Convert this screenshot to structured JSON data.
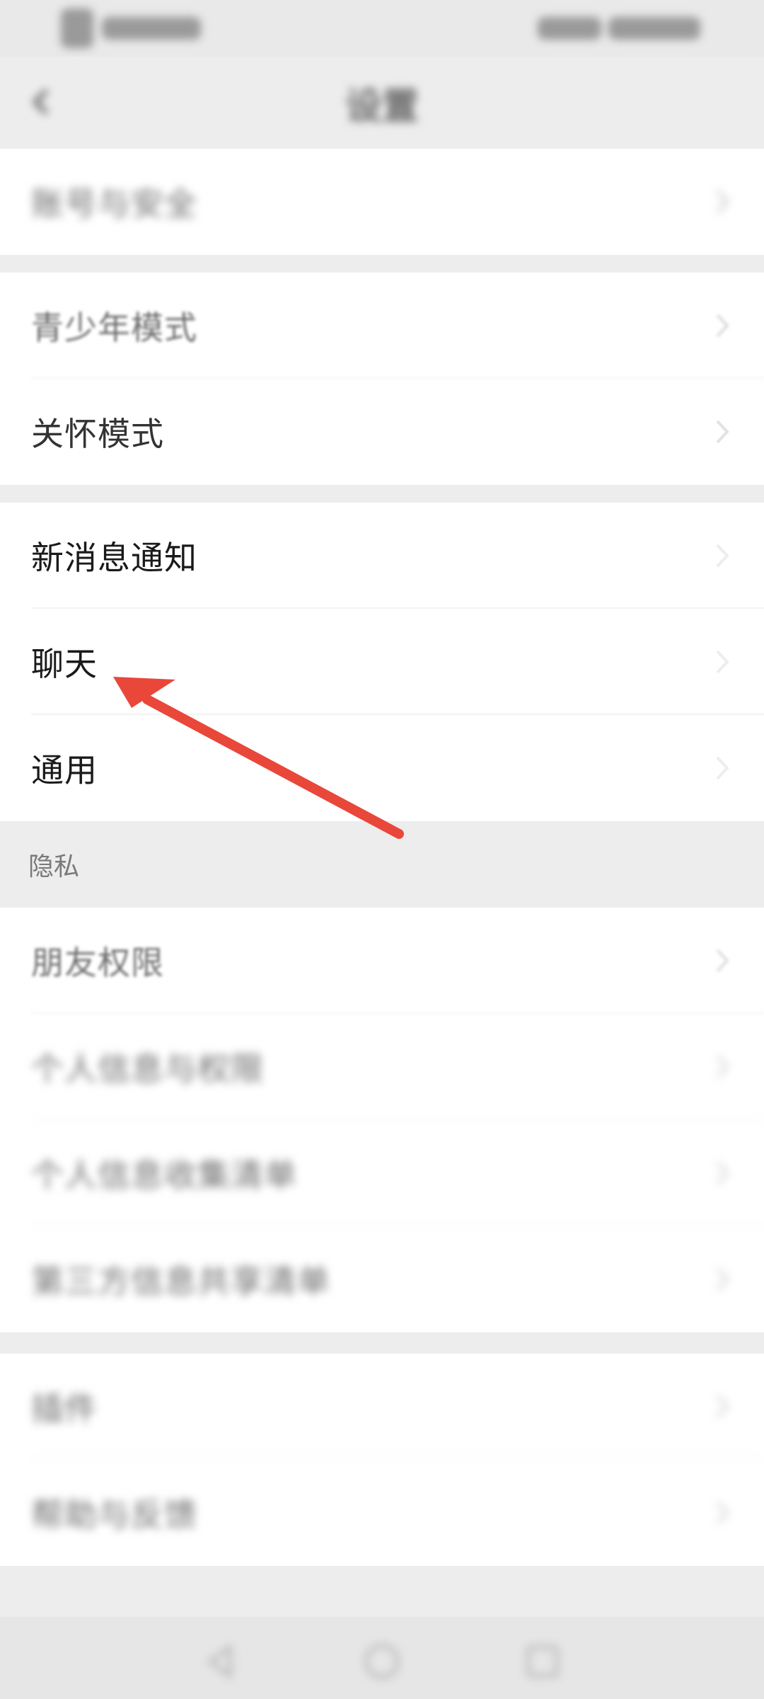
{
  "header": {
    "title": "设置"
  },
  "groups": {
    "account": {
      "label": "账号与安全"
    },
    "youth": {
      "label": "青少年模式"
    },
    "care": {
      "label": "关怀模式"
    },
    "notifications": {
      "label": "新消息通知"
    },
    "chat": {
      "label": "聊天"
    },
    "general": {
      "label": "通用"
    },
    "privacy_header": "隐私",
    "friend_permissions": {
      "label": "朋友权限"
    },
    "personal_info": {
      "label": "个人信息与权限"
    },
    "personal_collection": {
      "label": "个人信息收集清单"
    },
    "third_party": {
      "label": "第三方信息共享清单"
    },
    "plugins": {
      "label": "插件"
    },
    "help": {
      "label": "帮助与反馈"
    }
  },
  "icons": {
    "back": "back-arrow-icon",
    "chevron": "chevron-right-icon",
    "nav_back": "triangle-back-icon",
    "nav_home": "circle-home-icon",
    "nav_recent": "square-recent-icon"
  },
  "colors": {
    "accent_arrow": "#e8473a",
    "background": "#ededed",
    "section_bg": "#ffffff"
  }
}
